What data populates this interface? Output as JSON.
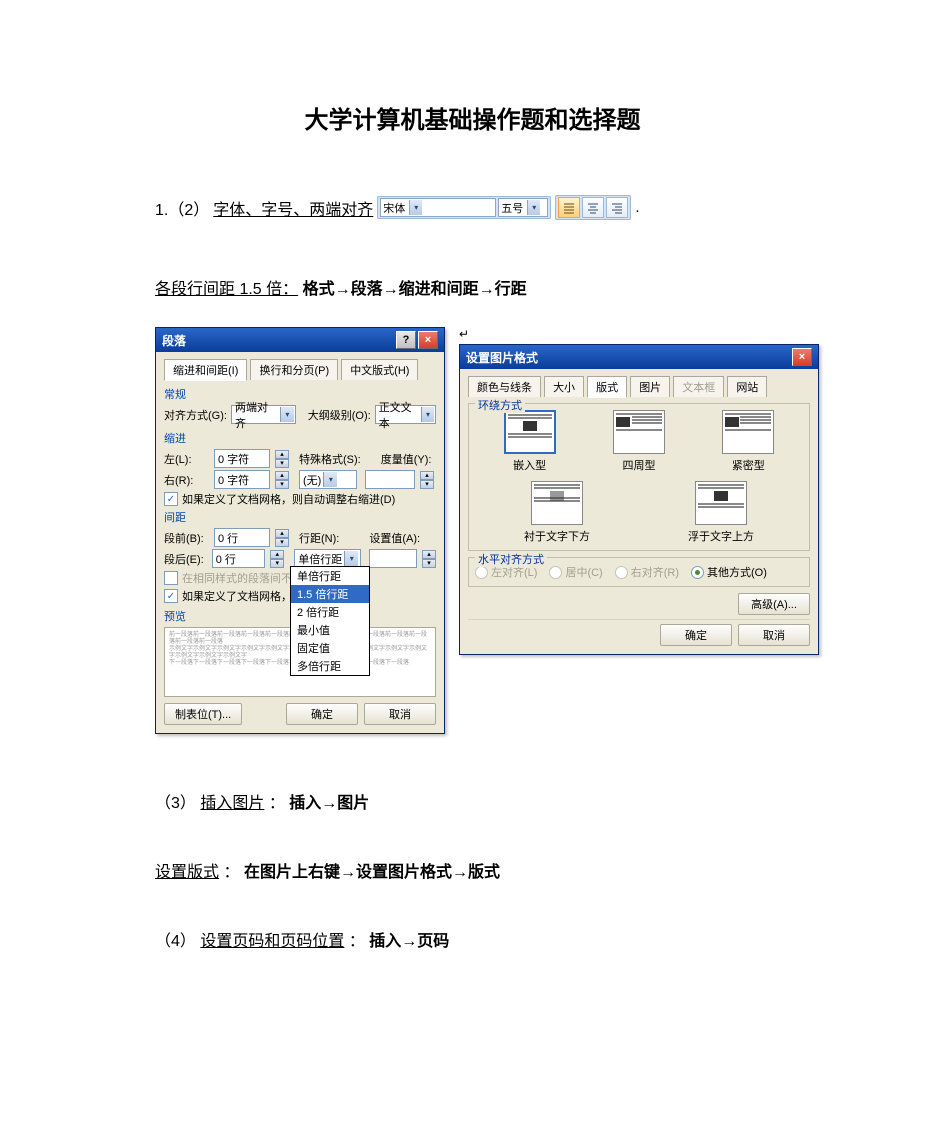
{
  "title": "大学计算机基础操作题和选择题",
  "line1": {
    "prefix": "1.（2）",
    "under": "字体、字号、两端对齐",
    "font_combo": "宋体",
    "size_combo": "五号",
    "align_icons": [
      "justify-icon",
      "center-icon",
      "right-icon"
    ]
  },
  "spacing": {
    "under": "各段行间距 1.5 倍：",
    "bold": "格式→段落→缩进和间距→行距"
  },
  "para_dialog": {
    "title": "段落",
    "tabs": [
      "缩进和间距(I)",
      "换行和分页(P)",
      "中文版式(H)"
    ],
    "sec_general": "常规",
    "align_label": "对齐方式(G):",
    "align_value": "两端对齐",
    "outline_label": "大纲级别(O):",
    "outline_value": "正文文本",
    "sec_indent": "缩进",
    "left_label": "左(L):",
    "left_value": "0 字符",
    "right_label": "右(R):",
    "right_value": "0 字符",
    "special_label": "特殊格式(S):",
    "special_value": "(无)",
    "by_label": "度量值(Y):",
    "chk_grid": "如果定义了文档网格，则自动调整右缩进(D)",
    "sec_spacing": "间距",
    "before_label": "段前(B):",
    "before_value": "0 行",
    "after_label": "段后(E):",
    "after_value": "0 行",
    "linespacing_label": "行距(N):",
    "linespacing_value": "单倍行距",
    "at_label": "设置值(A):",
    "chk_noadd": "在相同样式的段落间不添加空格(M)",
    "chk_grid2": "如果定义了文档网格，则对齐网格(W)",
    "options": [
      "单倍行距",
      "1.5 倍行距",
      "2 倍行距",
      "最小值",
      "固定值",
      "多倍行距"
    ],
    "sec_preview": "预览",
    "tabstops_btn": "制表位(T)...",
    "ok_btn": "确定",
    "cancel_btn": "取消"
  },
  "pic_dialog": {
    "title": "设置图片格式",
    "tabs": [
      "颜色与线条",
      "大小",
      "版式",
      "图片",
      "文本框",
      "网站"
    ],
    "legend_wrap": "环绕方式",
    "wrap_opts": [
      "嵌入型",
      "四周型",
      "紧密型",
      "衬于文字下方",
      "浮于文字上方"
    ],
    "legend_halign": "水平对齐方式",
    "radios": [
      "左对齐(L)",
      "居中(C)",
      "右对齐(R)",
      "其他方式(O)"
    ],
    "adv_btn": "高级(A)...",
    "ok_btn": "确定",
    "cancel_btn": "取消"
  },
  "line3": {
    "prefix": "（3）",
    "under": "插入图片",
    "sep": "：",
    "bold": "插入→图片"
  },
  "line4": {
    "under": "设置版式",
    "sep": "：",
    "bold": "在图片上右键→设置图片格式→版式"
  },
  "line5": {
    "prefix": "（4）",
    "under": "设置页码和页码位置",
    "sep": "：",
    "bold": "插入→页码"
  }
}
